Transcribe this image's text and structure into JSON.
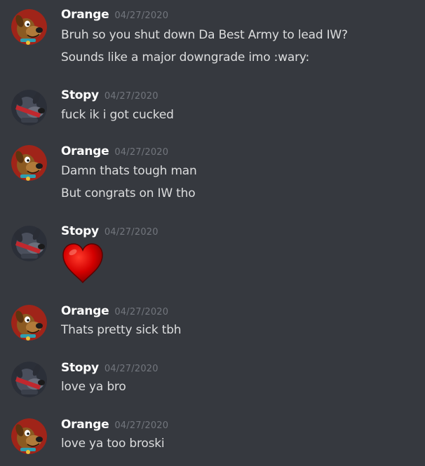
{
  "users": {
    "orange": {
      "name": "Orange",
      "avatar": "scooby-doo-avatar"
    },
    "stopy": {
      "name": "Stopy",
      "avatar": "stopy-avatar"
    }
  },
  "messages": [
    {
      "author": "Orange",
      "timestamp": "04/27/2020",
      "lines": [
        "Bruh so you shut down Da Best Army to lead IW?",
        "Sounds like a major downgrade imo :wary:"
      ]
    },
    {
      "author": "Stopy",
      "timestamp": "04/27/2020",
      "lines": [
        "fuck ik i got cucked"
      ]
    },
    {
      "author": "Orange",
      "timestamp": "04/27/2020",
      "lines": [
        "Damn thats tough man",
        "But congrats on IW tho"
      ]
    },
    {
      "author": "Stopy",
      "timestamp": "04/27/2020",
      "emoji": "heart-emoji"
    },
    {
      "author": "Orange",
      "timestamp": "04/27/2020",
      "lines": [
        "Thats pretty sick tbh"
      ]
    },
    {
      "author": "Stopy",
      "timestamp": "04/27/2020",
      "lines": [
        "love ya bro"
      ]
    },
    {
      "author": "Orange",
      "timestamp": "04/27/2020",
      "lines": [
        "love ya too broski"
      ]
    }
  ],
  "colors": {
    "background": "#36393f",
    "username": "#ffffff",
    "timestamp": "#72767d",
    "text": "#dcddde",
    "heart": "#d40000"
  }
}
